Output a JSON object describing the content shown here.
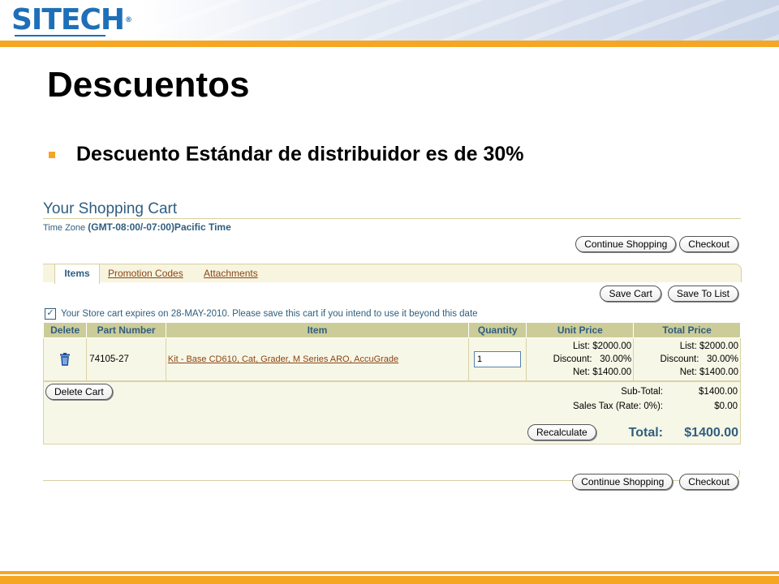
{
  "logo": {
    "text": "SITECH",
    "mark": "®"
  },
  "slide": {
    "title": "Descuentos",
    "bullet": "Descuento Estándar de distribuidor es de 30%"
  },
  "cart": {
    "title": "Your Shopping Cart",
    "time_zone_label": "Time Zone",
    "time_zone_value": "(GMT-08:00/-07:00)Pacific Time",
    "continue_label": "Continue Shopping",
    "checkout_label": "Checkout",
    "tabs": [
      "Items",
      "Promotion Codes",
      "Attachments"
    ],
    "save_cart_label": "Save Cart",
    "save_to_list_label": "Save To List",
    "expire_notice": "Your Store cart expires on 28-MAY-2010. Please save this cart if you intend to use it beyond this date",
    "columns": [
      "Delete",
      "Part Number",
      "Item",
      "Quantity",
      "Unit Price",
      "Total Price"
    ],
    "rows": [
      {
        "part_number": "74105-27",
        "item": "Kit - Base CD610, Cat, Grader, M Series ARO, AccuGrade",
        "quantity": "1",
        "unit_list": "List: $2000.00",
        "unit_discount": "Discount:   30.00%",
        "unit_net": "Net: $1400.00",
        "total_list": "List: $2000.00",
        "total_discount": "Discount:   30.00%",
        "total_net": "Net: $1400.00"
      }
    ],
    "delete_cart_label": "Delete Cart",
    "subtotal_label": "Sub-Total:",
    "subtotal_value": "$1400.00",
    "tax_label": "Sales Tax (Rate: 0%):",
    "tax_value": "$0.00",
    "recalculate_label": "Recalculate",
    "total_label": "Total:",
    "total_value": "$1400.00"
  },
  "colors": {
    "accent_orange": "#f5a623",
    "brand_blue": "#1d6fb8",
    "header_tan": "#cccc99"
  }
}
